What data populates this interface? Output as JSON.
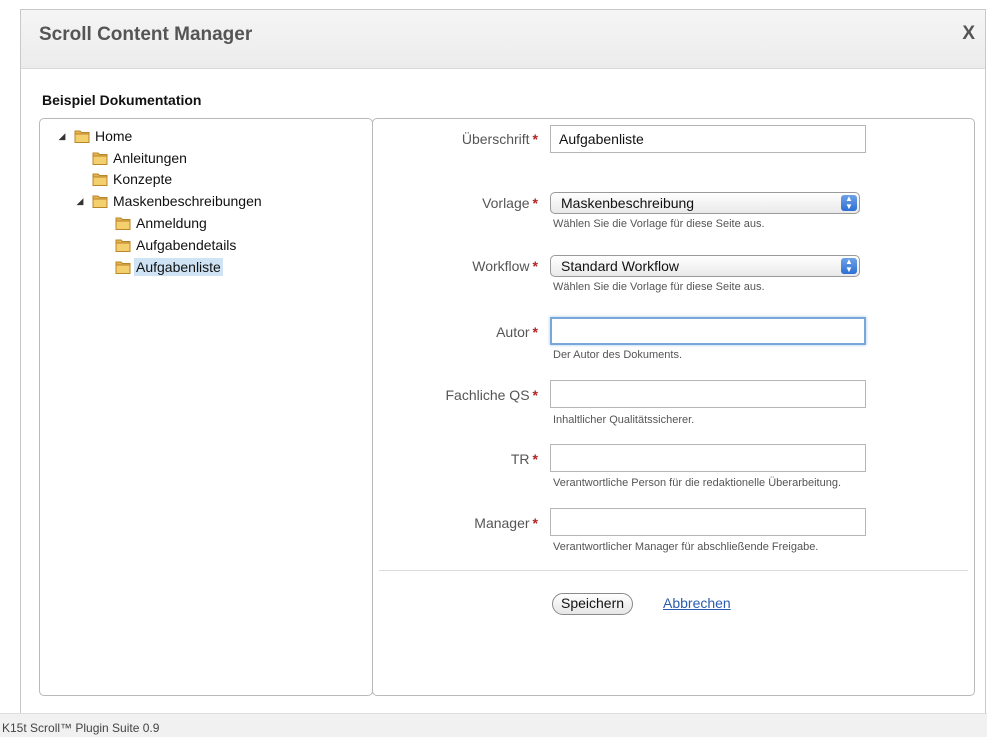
{
  "dialog": {
    "title": "Scroll Content Manager",
    "close_label": "X"
  },
  "space_title": "Beispiel Dokumentation",
  "tree": {
    "home": "Home",
    "anleitungen": "Anleitungen",
    "konzepte": "Konzepte",
    "maskenbeschreibungen": "Maskenbeschreibungen",
    "anmeldung": "Anmeldung",
    "aufgabendetails": "Aufgabendetails",
    "aufgabenliste": "Aufgabenliste",
    "selected": "Aufgabenliste"
  },
  "form": {
    "required_marker": "*",
    "heading": {
      "label": "Überschrift",
      "value": "Aufgabenliste"
    },
    "template": {
      "label": "Vorlage",
      "value": "Maskenbeschreibung",
      "hint": "Wählen Sie die Vorlage für diese Seite aus."
    },
    "workflow": {
      "label": "Workflow",
      "value": "Standard Workflow",
      "hint": "Wählen Sie die Vorlage für diese Seite aus."
    },
    "author": {
      "label": "Autor",
      "value": "",
      "hint": "Der Autor des Dokuments."
    },
    "qa": {
      "label": "Fachliche QS",
      "value": "",
      "hint": "Inhaltlicher Qualitätssicherer."
    },
    "tr": {
      "label": "TR",
      "value": "",
      "hint": "Verantwortliche Person für die redaktionelle Überarbeitung."
    },
    "manager": {
      "label": "Manager",
      "value": "",
      "hint": "Verantwortlicher Manager für abschließende Freigabe."
    },
    "save_label": "Speichern",
    "cancel_label": "Abbrechen"
  },
  "footer": {
    "text": "K15t Scroll™ Plugin Suite 0.9"
  },
  "colors": {
    "required": "#b32424",
    "selection": "#cfe3f5",
    "link": "#2a5db0"
  }
}
